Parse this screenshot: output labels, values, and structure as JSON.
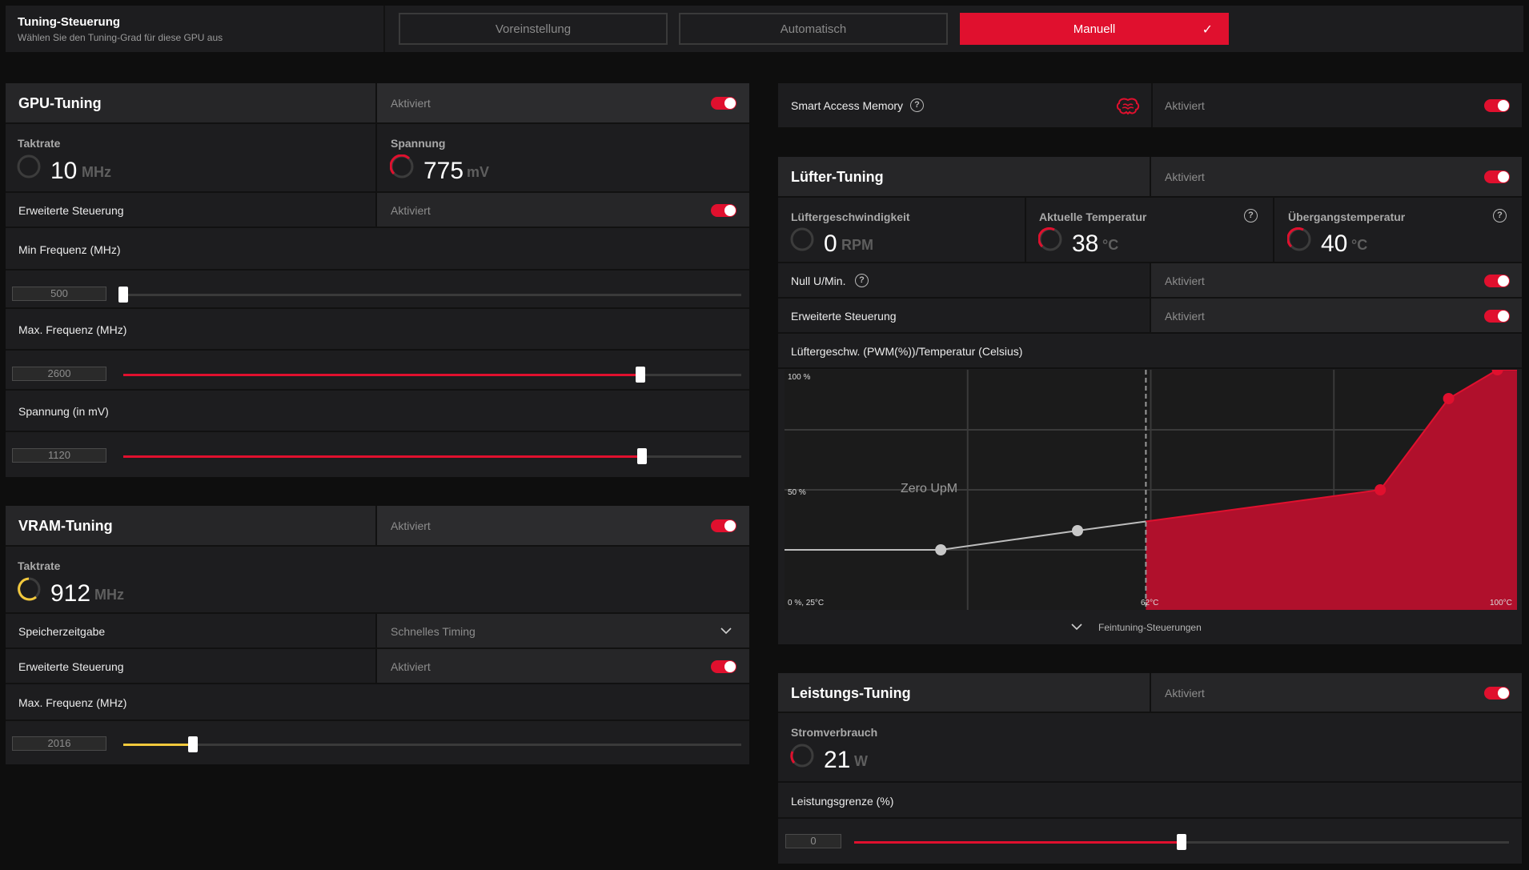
{
  "header": {
    "title": "Tuning-Steuerung",
    "subtitle": "Wählen Sie den Tuning-Grad für diese GPU aus",
    "modes": [
      "Voreinstellung",
      "Automatisch",
      "Manuell"
    ],
    "active_mode": "Manuell",
    "check_glyph": "✓"
  },
  "colors": {
    "accent": "#e0102e",
    "vram": "#f3c93c",
    "panel": "#1d1d1f",
    "background": "#0e0e0e"
  },
  "gpu_tuning": {
    "title": "GPU-Tuning",
    "status": "Aktiviert",
    "enabled": true,
    "clock_label": "Taktrate",
    "clock_value": "10",
    "clock_unit": "MHz",
    "voltage_label": "Spannung",
    "voltage_value": "775",
    "voltage_unit": "mV",
    "advanced_label": "Erweiterte Steuerung",
    "advanced_status": "Aktiviert",
    "min_freq_label": "Min Frequenz (MHz)",
    "min_freq_value": "500",
    "min_freq_fraction": 0.0,
    "max_freq_label": "Max. Frequenz (MHz)",
    "max_freq_value": "2600",
    "max_freq_fraction": 0.837,
    "voltage_slider_label": "Spannung (in mV)",
    "voltage_slider_value": "1120",
    "voltage_slider_fraction": 0.84
  },
  "vram_tuning": {
    "title": "VRAM-Tuning",
    "status": "Aktiviert",
    "enabled": true,
    "clock_label": "Taktrate",
    "clock_value": "912",
    "clock_unit": "MHz",
    "timing_label": "Speicherzeitgabe",
    "timing_value": "Schnelles Timing",
    "advanced_label": "Erweiterte Steuerung",
    "advanced_status": "Aktiviert",
    "max_freq_label": "Max. Frequenz (MHz)",
    "max_freq_value": "2016",
    "max_freq_fraction": 0.113
  },
  "smart_access_memory": {
    "label": "Smart Access Memory",
    "help": "?",
    "status": "Aktiviert",
    "icon": "brain-icon"
  },
  "fan_tuning": {
    "title": "Lüfter-Tuning",
    "status": "Aktiviert",
    "fan_speed_label": "Lüftergeschwindigkeit",
    "fan_speed_value": "0",
    "fan_speed_unit": "RPM",
    "current_temp_label": "Aktuelle Temperatur",
    "current_temp_value": "38",
    "current_temp_unit": "°C",
    "transition_temp_label": "Übergangstemperatur",
    "transition_temp_value": "40",
    "transition_temp_unit": "°C",
    "zero_rpm_label": "Null U/Min.",
    "zero_rpm_status": "Aktiviert",
    "advanced_label": "Erweiterte Steuerung",
    "advanced_status": "Aktiviert",
    "curve_title": "Lüftergeschw. (PWM(%))/Temperatur (Celsius)",
    "fine_tuning_label": "Feintuning-Steuerungen"
  },
  "chart_data": {
    "type": "area",
    "title": "Lüftergeschw. (PWM(%))/Temperatur (Celsius)",
    "x_tick_labels": [
      "0 %, 25°C",
      "62°C",
      "100°C"
    ],
    "y_tick_labels": [
      "100 %",
      "50 %"
    ],
    "annotation": "Zero UpM",
    "xlim": [
      25,
      100
    ],
    "ylim": [
      0,
      100
    ],
    "zero_rpm_threshold_x": 62,
    "grid": true,
    "points": [
      {
        "x": 41,
        "y": 25
      },
      {
        "x": 55,
        "y": 33
      },
      {
        "x": 86,
        "y": 50
      },
      {
        "x": 93,
        "y": 88
      },
      {
        "x": 98,
        "y": 100
      }
    ]
  },
  "power_tuning": {
    "title": "Leistungs-Tuning",
    "status": "Aktiviert",
    "power_label": "Stromverbrauch",
    "power_value": "21",
    "power_unit": "W",
    "limit_label": "Leistungsgrenze (%)",
    "limit_value": "0",
    "limit_fraction": 0.5
  }
}
